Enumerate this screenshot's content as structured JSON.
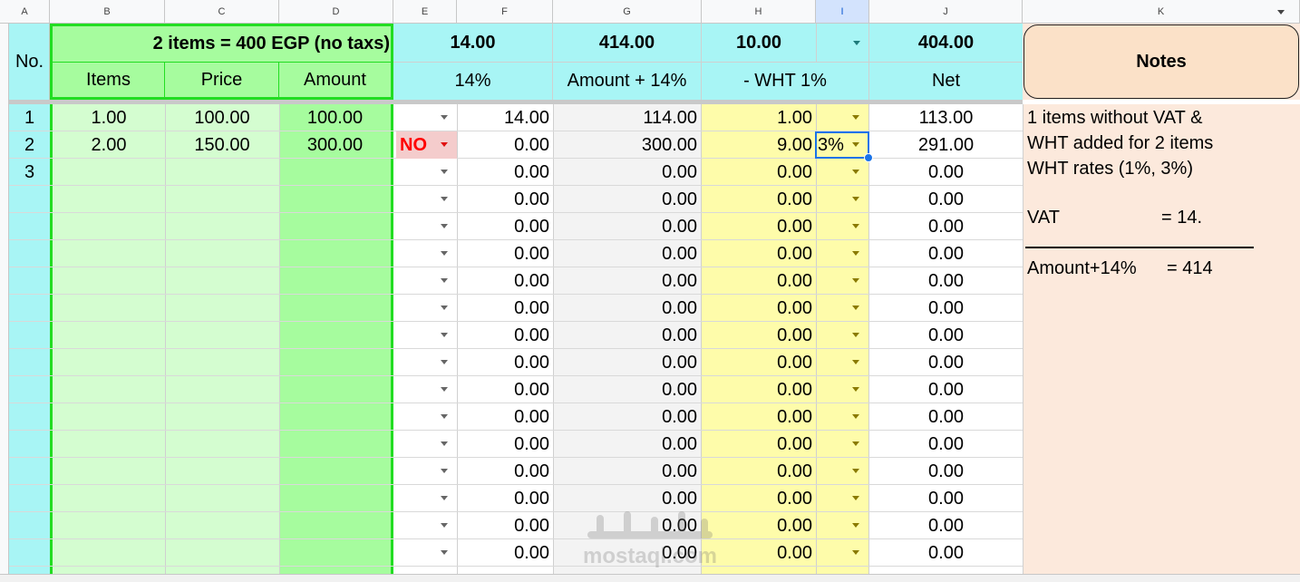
{
  "column_headers": [
    "A",
    "B",
    "C",
    "D",
    "E",
    "F",
    "G",
    "H",
    "I",
    "J",
    "K"
  ],
  "header": {
    "no_label": "No.",
    "summary": "2 items = 400 EGP (no taxs)",
    "items_label": "Items",
    "price_label": "Price",
    "amount_label": "Amount",
    "vat_total": "14.00",
    "vat_label": "14%",
    "amount_vat_total": "414.00",
    "amount_vat_label": "Amount + 14%",
    "wht_total": "10.00",
    "wht_label": "- WHT 1%",
    "net_total": "404.00",
    "net_label": "Net",
    "notes_title": "Notes"
  },
  "rows": [
    {
      "no": "1",
      "items": "1.00",
      "price": "100.00",
      "amount": "100.00",
      "flag": "",
      "vat": "14.00",
      "amount_vat": "114.00",
      "wht": "1.00",
      "wht_rate": "",
      "net": "113.00"
    },
    {
      "no": "2",
      "items": "2.00",
      "price": "150.00",
      "amount": "300.00",
      "flag": "NO",
      "vat": "0.00",
      "amount_vat": "300.00",
      "wht": "9.00",
      "wht_rate": "3%",
      "net": "291.00"
    },
    {
      "no": "3",
      "items": "",
      "price": "",
      "amount": "",
      "flag": "",
      "vat": "0.00",
      "amount_vat": "0.00",
      "wht": "0.00",
      "wht_rate": "",
      "net": "0.00"
    },
    {
      "no": "",
      "items": "",
      "price": "",
      "amount": "",
      "flag": "",
      "vat": "0.00",
      "amount_vat": "0.00",
      "wht": "0.00",
      "wht_rate": "",
      "net": "0.00"
    },
    {
      "no": "",
      "items": "",
      "price": "",
      "amount": "",
      "flag": "",
      "vat": "0.00",
      "amount_vat": "0.00",
      "wht": "0.00",
      "wht_rate": "",
      "net": "0.00"
    },
    {
      "no": "",
      "items": "",
      "price": "",
      "amount": "",
      "flag": "",
      "vat": "0.00",
      "amount_vat": "0.00",
      "wht": "0.00",
      "wht_rate": "",
      "net": "0.00"
    },
    {
      "no": "",
      "items": "",
      "price": "",
      "amount": "",
      "flag": "",
      "vat": "0.00",
      "amount_vat": "0.00",
      "wht": "0.00",
      "wht_rate": "",
      "net": "0.00"
    },
    {
      "no": "",
      "items": "",
      "price": "",
      "amount": "",
      "flag": "",
      "vat": "0.00",
      "amount_vat": "0.00",
      "wht": "0.00",
      "wht_rate": "",
      "net": "0.00"
    },
    {
      "no": "",
      "items": "",
      "price": "",
      "amount": "",
      "flag": "",
      "vat": "0.00",
      "amount_vat": "0.00",
      "wht": "0.00",
      "wht_rate": "",
      "net": "0.00"
    },
    {
      "no": "",
      "items": "",
      "price": "",
      "amount": "",
      "flag": "",
      "vat": "0.00",
      "amount_vat": "0.00",
      "wht": "0.00",
      "wht_rate": "",
      "net": "0.00"
    },
    {
      "no": "",
      "items": "",
      "price": "",
      "amount": "",
      "flag": "",
      "vat": "0.00",
      "amount_vat": "0.00",
      "wht": "0.00",
      "wht_rate": "",
      "net": "0.00"
    },
    {
      "no": "",
      "items": "",
      "price": "",
      "amount": "",
      "flag": "",
      "vat": "0.00",
      "amount_vat": "0.00",
      "wht": "0.00",
      "wht_rate": "",
      "net": "0.00"
    },
    {
      "no": "",
      "items": "",
      "price": "",
      "amount": "",
      "flag": "",
      "vat": "0.00",
      "amount_vat": "0.00",
      "wht": "0.00",
      "wht_rate": "",
      "net": "0.00"
    },
    {
      "no": "",
      "items": "",
      "price": "",
      "amount": "",
      "flag": "",
      "vat": "0.00",
      "amount_vat": "0.00",
      "wht": "0.00",
      "wht_rate": "",
      "net": "0.00"
    },
    {
      "no": "",
      "items": "",
      "price": "",
      "amount": "",
      "flag": "",
      "vat": "0.00",
      "amount_vat": "0.00",
      "wht": "0.00",
      "wht_rate": "",
      "net": "0.00"
    },
    {
      "no": "",
      "items": "",
      "price": "",
      "amount": "",
      "flag": "",
      "vat": "0.00",
      "amount_vat": "0.00",
      "wht": "0.00",
      "wht_rate": "",
      "net": "0.00"
    },
    {
      "no": "",
      "items": "",
      "price": "",
      "amount": "",
      "flag": "",
      "vat": "0.00",
      "amount_vat": "0.00",
      "wht": "0.00",
      "wht_rate": "",
      "net": "0.00"
    }
  ],
  "notes": {
    "line1": "1 items without VAT &",
    "line2": "WHT added for 2 items",
    "line3": "WHT rates  (1%, 3%)",
    "vat_key": "VAT",
    "vat_value": "= 14.",
    "amount_key": "Amount+14%",
    "amount_value": "= 414"
  },
  "watermark": "mostaql.com",
  "colors": {
    "teal_fill": "#a8f5f5",
    "green_light": "#d4fdd0",
    "green_dark": "#a6fc9e",
    "green_border": "#22dd22",
    "gray_fill": "#f3f3f3",
    "yellow_fill": "#fefcaa",
    "notes_fill": "#fce9dc",
    "notes_header_fill": "#fbe1c8",
    "flag_fill": "#f4cccc",
    "flag_text": "#ff0000",
    "selection": "#1a73e8"
  }
}
